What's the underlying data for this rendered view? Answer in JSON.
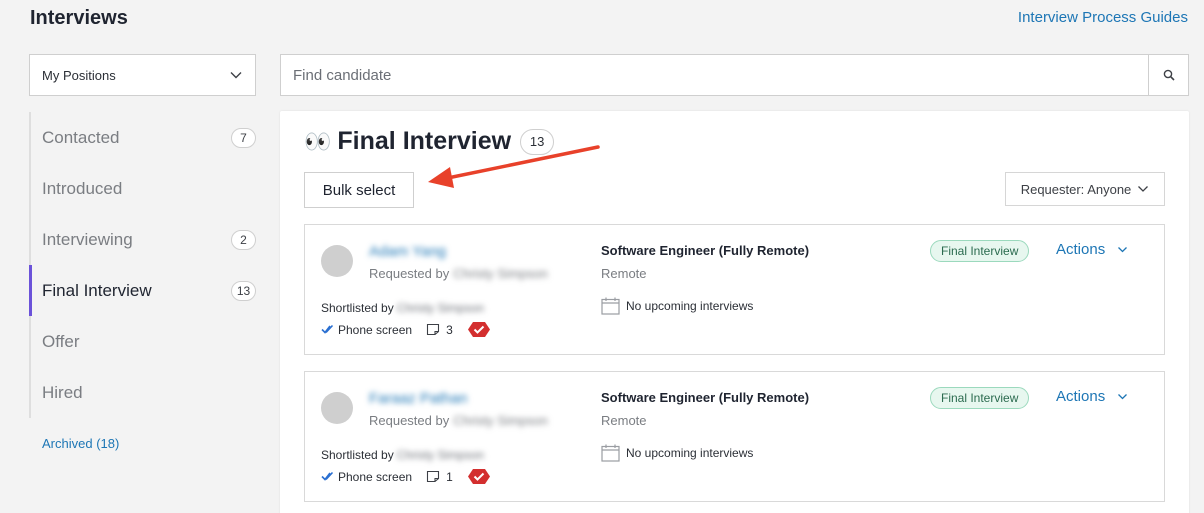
{
  "header": {
    "title": "Interviews",
    "guides_link": "Interview Process Guides"
  },
  "filters": {
    "positions_selected": "My Positions",
    "search_placeholder": "Find candidate"
  },
  "stages": [
    {
      "label": "Contacted",
      "count": "7"
    },
    {
      "label": "Introduced",
      "count": ""
    },
    {
      "label": "Interviewing",
      "count": "2"
    },
    {
      "label": "Final Interview",
      "count": "13"
    },
    {
      "label": "Offer",
      "count": ""
    },
    {
      "label": "Hired",
      "count": ""
    }
  ],
  "archived_link": "Archived (18)",
  "panel": {
    "title": "Final Interview",
    "count": "13",
    "bulk_select": "Bulk select",
    "requester": "Requester: Anyone"
  },
  "candidates": [
    {
      "name": "Adam Yang",
      "requested_by_label": "Requested by",
      "requested_by": "Christy Simpson",
      "shortlisted_label": "Shortlisted by",
      "shortlisted_by": "Christy Simpson",
      "phone_screen": "Phone screen",
      "notes_count": "3",
      "job_title": "Software Engineer (Fully Remote)",
      "location": "Remote",
      "interviews": "No upcoming interviews",
      "status": "Final Interview",
      "actions": "Actions"
    },
    {
      "name": "Faraaz Pathan",
      "requested_by_label": "Requested by",
      "requested_by": "Christy Simpson",
      "shortlisted_label": "Shortlisted by",
      "shortlisted_by": "Christy Simpson",
      "phone_screen": "Phone screen",
      "notes_count": "1",
      "job_title": "Software Engineer (Fully Remote)",
      "location": "Remote",
      "interviews": "No upcoming interviews",
      "status": "Final Interview",
      "actions": "Actions"
    }
  ],
  "colors": {
    "accent": "#1d76b5",
    "active_stage": "#6b52d9",
    "status_bg": "#e7f7ef",
    "arrow": "#e8412a"
  }
}
